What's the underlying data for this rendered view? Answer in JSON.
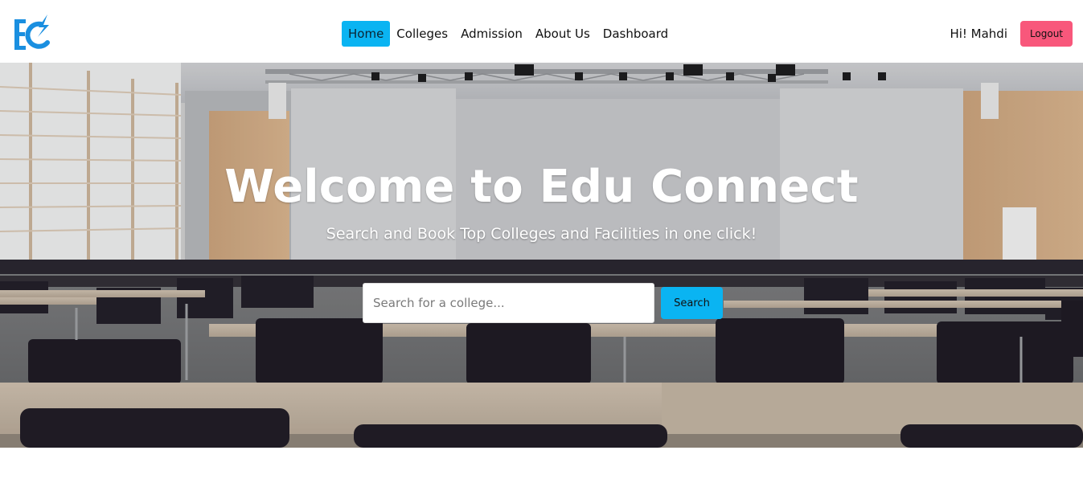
{
  "nav": {
    "links": [
      "Home",
      "Colleges",
      "Admission",
      "About Us",
      "Dashboard"
    ],
    "greeting": "Hi! Mahdi",
    "logout_label": "Logout"
  },
  "hero": {
    "title": "Welcome to Edu Connect",
    "subtitle": "Search and Book Top Colleges and Facilities in one click!",
    "search_placeholder": "Search for a college...",
    "search_value": "",
    "search_button": "Search",
    "background": "conference-hall-photo"
  },
  "colors": {
    "accent": "#0ab4f2",
    "logout": "#f8577b",
    "logo": "#1a8fe0"
  },
  "icons": {
    "logo": "edu-connect-logo-icon"
  }
}
